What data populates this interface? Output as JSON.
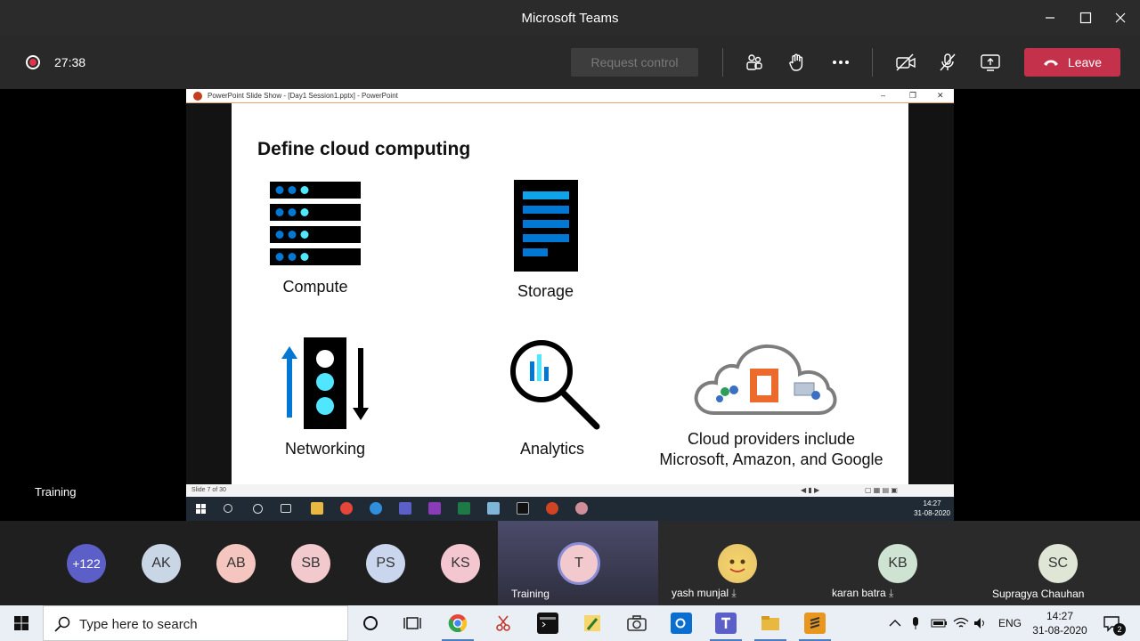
{
  "window": {
    "title": "Microsoft Teams"
  },
  "meeting": {
    "timer": "27:38",
    "request_control_label": "Request control",
    "leave_label": "Leave",
    "leave_color": "#c4314b"
  },
  "powerpoint": {
    "window_title": "PowerPoint Slide Show - [Day1 Session1.pptx] - PowerPoint",
    "status": "Slide 7 of 30",
    "slide": {
      "title": "Define cloud computing",
      "items": [
        "Compute",
        "Storage",
        "Networking",
        "Analytics"
      ],
      "cloud_caption_line1": "Cloud providers include",
      "cloud_caption_line2": "Microsoft, Amazon, and Google"
    },
    "inner_clock": {
      "time": "14:27",
      "date": "31-08-2020"
    }
  },
  "presenter_label": "Training",
  "roster": {
    "overflow": "+122",
    "avatars": [
      {
        "initials": "AK",
        "color": "#c8d6e5"
      },
      {
        "initials": "AB",
        "color": "#f5c6c0"
      },
      {
        "initials": "SB",
        "color": "#f2c9cc"
      },
      {
        "initials": "PS",
        "color": "#c9d6ee"
      },
      {
        "initials": "KS",
        "color": "#f3c6d0"
      }
    ],
    "tiles": [
      {
        "initials": "T",
        "name": "Training"
      },
      {
        "initials": "",
        "name": "yash munjal"
      },
      {
        "initials": "KB",
        "name": "karan batra"
      },
      {
        "initials": "SC",
        "name": "Supragya Chauhan"
      }
    ]
  },
  "taskbar": {
    "search_placeholder": "Type here to search",
    "language": "ENG",
    "time": "14:27",
    "date": "31-08-2020",
    "notification_count": "2"
  }
}
